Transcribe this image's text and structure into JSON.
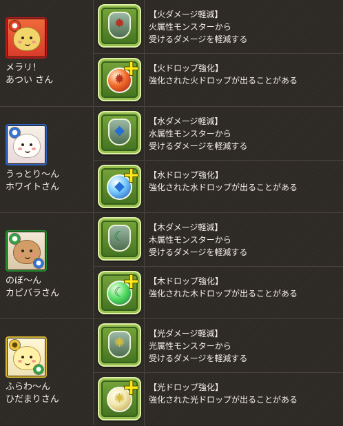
{
  "rows": [
    {
      "monster": {
        "name_line1": "メラリ！",
        "name_line2": "あつい さん",
        "attribute": "fire",
        "attribute_icon": "fire-attribute-icon",
        "portrait_icon": "fire-cat-portrait",
        "color": "#b51b1b"
      },
      "skills": [
        {
          "title": "【火ダメージ軽減】",
          "description_line1": "火属性モンスターから",
          "description_line2": "受けるダメージを軽減する",
          "icon": "fire-damage-reduction-icon"
        },
        {
          "title": "【火ドロップ強化】",
          "description_line1": "強化された火ドロップが出ることがある",
          "description_line2": "",
          "icon": "fire-drop-enhance-icon"
        }
      ]
    },
    {
      "monster": {
        "name_line1": "うっとり～ん",
        "name_line2": "ホワイトさん",
        "attribute": "water",
        "attribute_icon": "water-attribute-icon",
        "portrait_icon": "water-cat-portrait",
        "color": "#2f62bd"
      },
      "skills": [
        {
          "title": "【水ダメージ軽減】",
          "description_line1": "水属性モンスターから",
          "description_line2": "受けるダメージを軽減する",
          "icon": "water-damage-reduction-icon"
        },
        {
          "title": "【水ドロップ強化】",
          "description_line1": "強化された水ドロップが出ることがある",
          "description_line2": "",
          "icon": "water-drop-enhance-icon"
        }
      ]
    },
    {
      "monster": {
        "name_line1": "のぼ～ん",
        "name_line2": "カピバラさん",
        "attribute": "wood",
        "attribute_icon": "wood-attribute-icon",
        "portrait_icon": "wood-capybara-portrait",
        "color": "#238a2f"
      },
      "skills": [
        {
          "title": "【木ダメージ軽減】",
          "description_line1": "木属性モンスターから",
          "description_line2": "受けるダメージを軽減する",
          "icon": "wood-damage-reduction-icon"
        },
        {
          "title": "【木ドロップ強化】",
          "description_line1": "強化された木ドロップが出ることがある",
          "description_line2": "",
          "icon": "wood-drop-enhance-icon"
        }
      ]
    },
    {
      "monster": {
        "name_line1": "ふらわ～ん",
        "name_line2": "ひだまりさん",
        "attribute": "light",
        "attribute_icon": "light-attribute-icon",
        "portrait_icon": "light-flower-portrait",
        "color": "#d7b632"
      },
      "skills": [
        {
          "title": "【光ダメージ軽減】",
          "description_line1": "光属性モンスターから",
          "description_line2": "受けるダメージを軽減する",
          "icon": "light-damage-reduction-icon"
        },
        {
          "title": "【光ドロップ強化】",
          "description_line1": "強化された光ドロップが出ることがある",
          "description_line2": "",
          "icon": "light-drop-enhance-icon"
        }
      ]
    }
  ]
}
